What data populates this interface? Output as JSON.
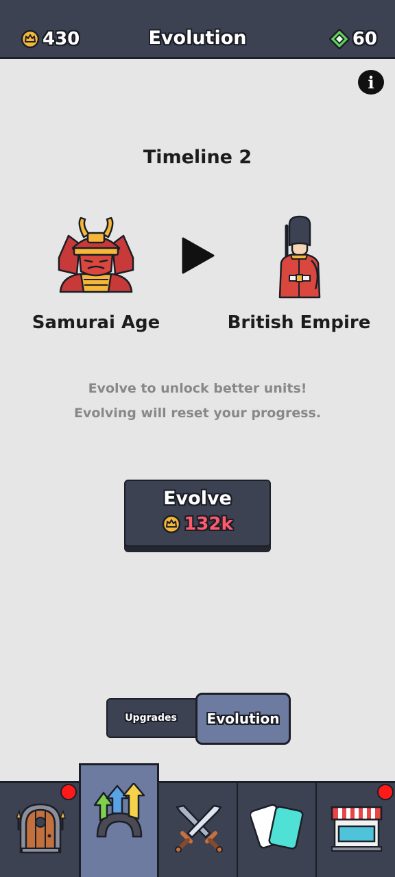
{
  "header": {
    "title": "Evolution",
    "coins": "430",
    "gems": "60",
    "coin_icon": "crown-coin-icon",
    "gem_icon": "green-gem-icon"
  },
  "info_icon": "info-icon",
  "timeline": {
    "title": "Timeline 2",
    "current_era": "Samurai Age",
    "next_era": "British Empire",
    "current_icon": "samurai-helmet-icon",
    "next_icon": "british-guard-icon",
    "arrow_icon": "play-arrow-icon"
  },
  "description": {
    "line1": "Evolve to unlock better units!",
    "line2": "Evolving will reset your progress."
  },
  "evolve_button": {
    "label": "Evolve",
    "cost": "132k",
    "cost_color": "#ff5a6b"
  },
  "toggle": {
    "upgrades_label": "Upgrades",
    "evolution_label": "Evolution",
    "selected": "Evolution"
  },
  "bottom_nav": [
    {
      "icon": "dungeon-door-icon",
      "notification": true
    },
    {
      "icon": "evolution-arrows-icon",
      "active": true
    },
    {
      "icon": "crossed-swords-icon"
    },
    {
      "icon": "cards-icon"
    },
    {
      "icon": "shop-icon",
      "notification": true
    }
  ],
  "colors": {
    "panel": "#3d4253",
    "active_tab": "#6e7ba0",
    "background": "#e6e6e6",
    "notification": "#ff1a1a"
  }
}
